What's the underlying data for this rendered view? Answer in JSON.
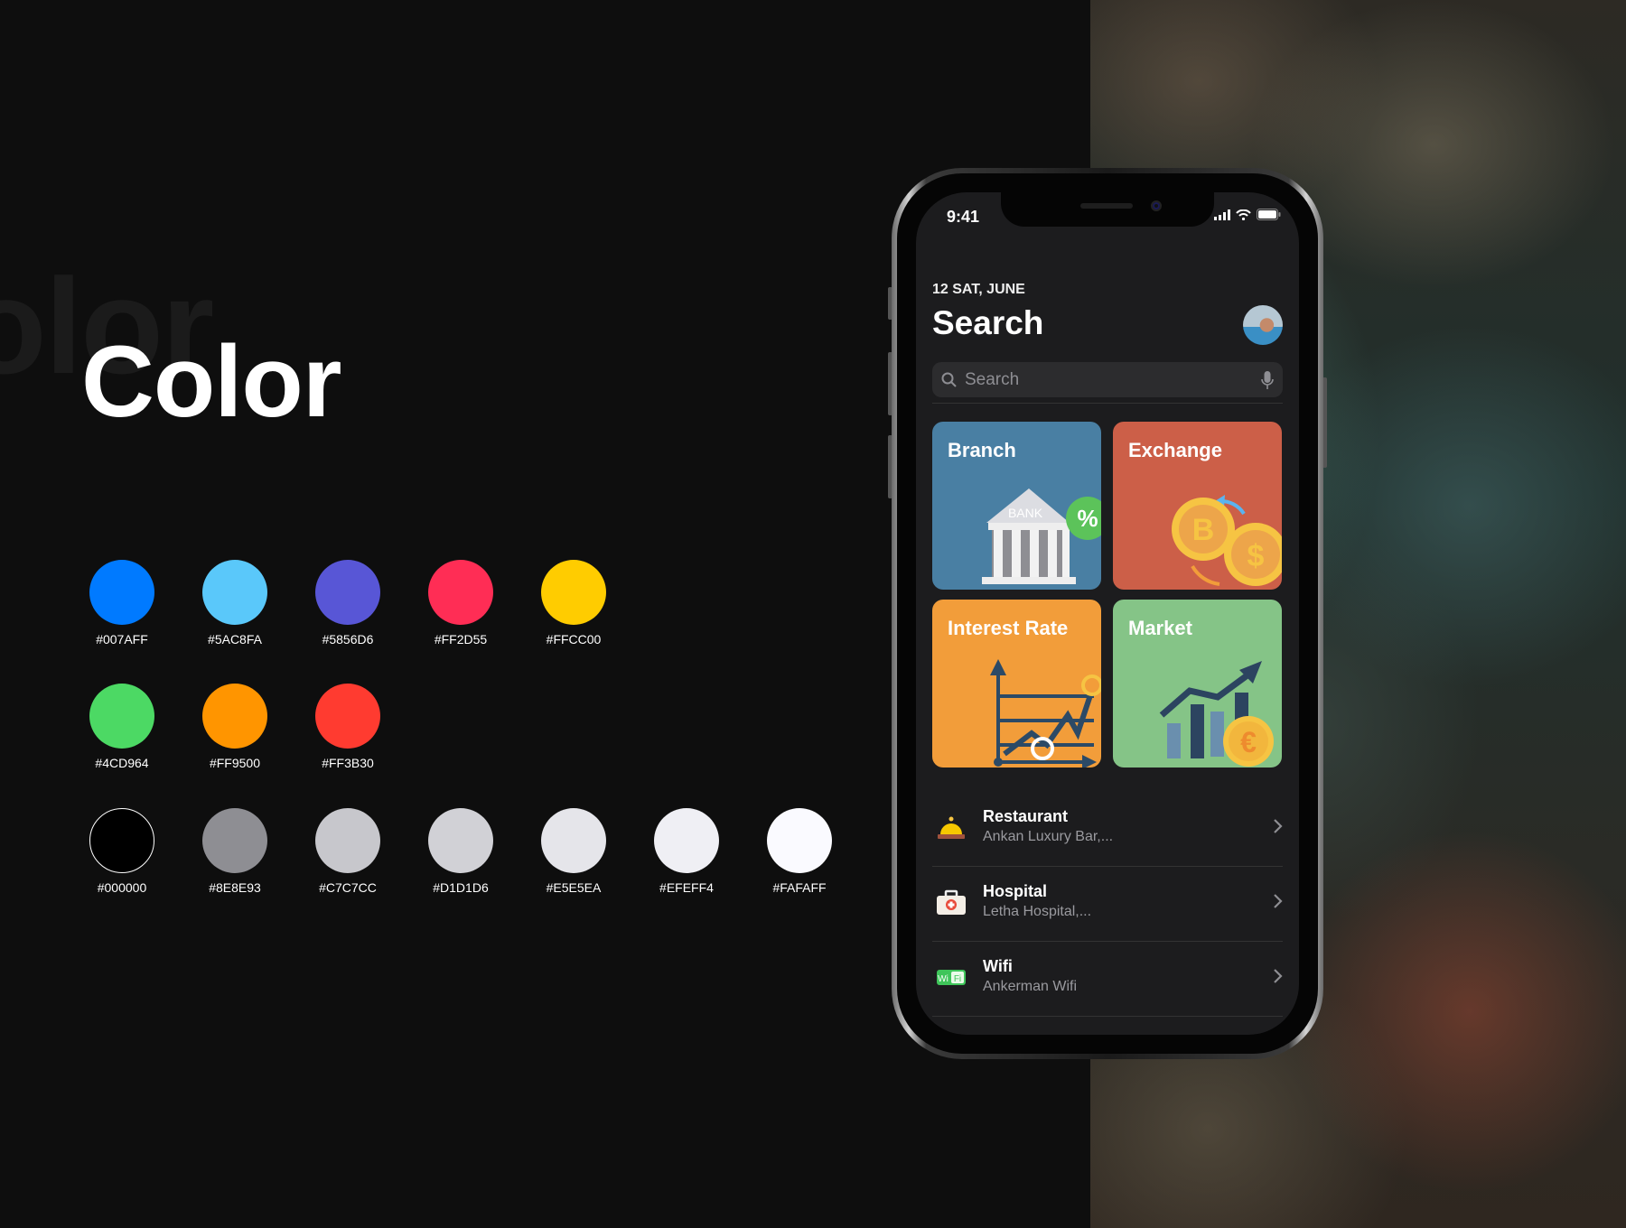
{
  "heading": {
    "ghost": "olor",
    "title": "Color"
  },
  "palette": {
    "row1": [
      {
        "hex": "#007AFF"
      },
      {
        "hex": "#5AC8FA"
      },
      {
        "hex": "#5856D6"
      },
      {
        "hex": "#FF2D55"
      },
      {
        "hex": "#FFCC00"
      }
    ],
    "row2": [
      {
        "hex": "#4CD964"
      },
      {
        "hex": "#FF9500"
      },
      {
        "hex": "#FF3B30"
      }
    ],
    "row3": [
      {
        "hex": "#000000"
      },
      {
        "hex": "#8E8E93"
      },
      {
        "hex": "#C7C7CC"
      },
      {
        "hex": "#D1D1D6"
      },
      {
        "hex": "#E5E5EA"
      },
      {
        "hex": "#EFEFF4"
      },
      {
        "hex": "#FAFAFF"
      }
    ]
  },
  "phone": {
    "status": {
      "time": "9:41",
      "icons": [
        "signal-icon",
        "wifi-icon",
        "battery-icon"
      ]
    },
    "date": "12 SAT, JUNE",
    "title": "Search",
    "search": {
      "placeholder": "Search",
      "value": "",
      "icon": "search-icon",
      "mic_icon": "microphone-icon"
    },
    "tiles": [
      {
        "label": "Branch",
        "color": "#497FA3",
        "icon": "bank-icon"
      },
      {
        "label": "Exchange",
        "color": "#CC5F48",
        "icon": "coins-exchange-icon"
      },
      {
        "label": "Interest Rate",
        "color": "#F29D3A",
        "icon": "line-chart-icon"
      },
      {
        "label": "Market",
        "color": "#85C487",
        "icon": "bar-chart-euro-icon"
      }
    ],
    "list": [
      {
        "title": "Restaurant",
        "subtitle": "Ankan Luxury Bar,...",
        "icon": "service-bell-icon"
      },
      {
        "title": "Hospital",
        "subtitle": "Letha Hospital,...",
        "icon": "first-aid-kit-icon"
      },
      {
        "title": "Wifi",
        "subtitle": "Ankerman Wifi",
        "icon": "wifi-sign-icon"
      }
    ]
  }
}
